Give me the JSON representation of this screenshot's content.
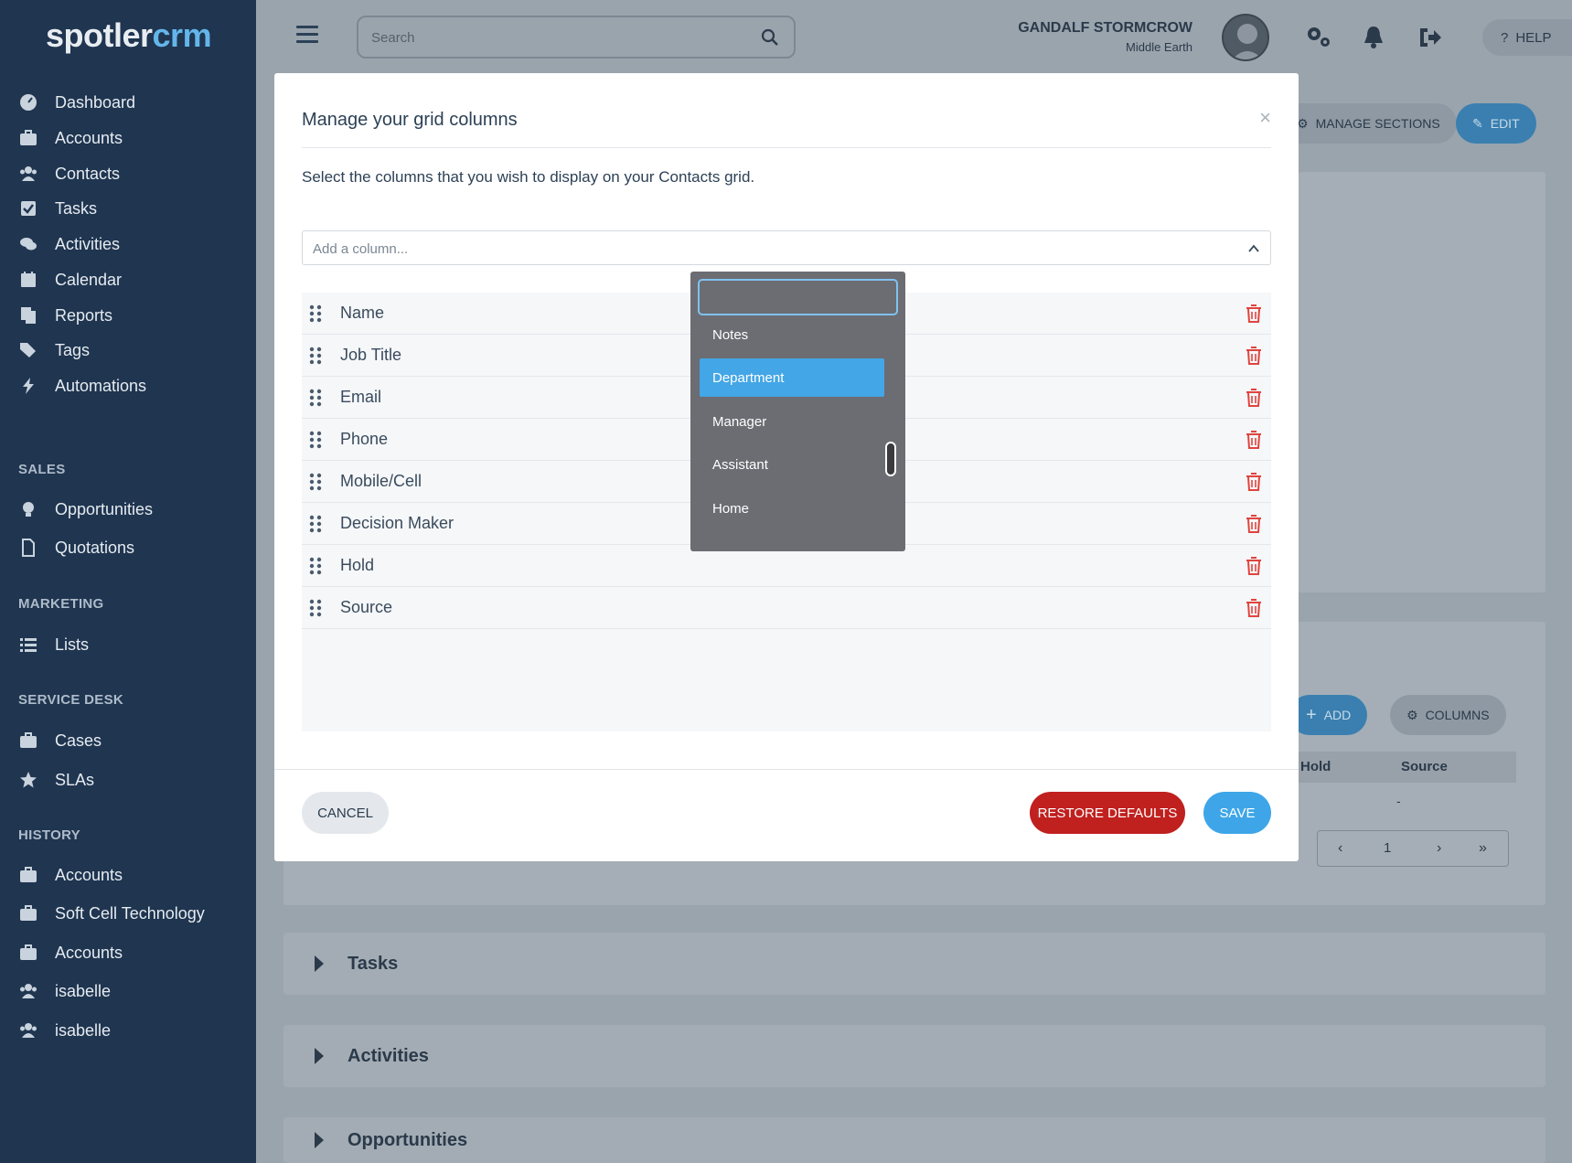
{
  "brand": {
    "part1": "spotler",
    "part2": "crm"
  },
  "sidebar": {
    "main_items": [
      {
        "label": "Dashboard",
        "icon": "dashboard-icon"
      },
      {
        "label": "Accounts",
        "icon": "briefcase-icon"
      },
      {
        "label": "Contacts",
        "icon": "users-icon"
      },
      {
        "label": "Tasks",
        "icon": "checkbox-icon"
      },
      {
        "label": "Activities",
        "icon": "comments-icon"
      },
      {
        "label": "Calendar",
        "icon": "calendar-icon"
      },
      {
        "label": "Reports",
        "icon": "files-icon"
      },
      {
        "label": "Tags",
        "icon": "tags-icon"
      },
      {
        "label": "Automations",
        "icon": "bolt-icon"
      }
    ],
    "sales_title": "SALES",
    "sales_items": [
      {
        "label": "Opportunities",
        "icon": "lightbulb-icon"
      },
      {
        "label": "Quotations",
        "icon": "file-icon"
      }
    ],
    "marketing_title": "MARKETING",
    "marketing_items": [
      {
        "label": "Lists",
        "icon": "list-icon"
      }
    ],
    "service_title": "SERVICE DESK",
    "service_items": [
      {
        "label": "Cases",
        "icon": "case-icon"
      },
      {
        "label": "SLAs",
        "icon": "star-icon"
      }
    ],
    "history_title": "HISTORY",
    "history_items": [
      {
        "label": "Accounts",
        "icon": "briefcase-icon"
      },
      {
        "label": "Soft Cell Technology",
        "icon": "briefcase-icon"
      },
      {
        "label": "Accounts",
        "icon": "briefcase-icon"
      },
      {
        "label": "isabelle",
        "icon": "users-icon"
      },
      {
        "label": "isabelle",
        "icon": "users-icon"
      }
    ]
  },
  "topbar": {
    "search_placeholder": "Search",
    "user_name": "GANDALF STORMCROW",
    "user_location": "Middle Earth",
    "help_label": "HELP"
  },
  "background": {
    "manage_sections_label": "MANAGE SECTIONS",
    "edit_label": "EDIT",
    "add_label": "ADD",
    "columns_label": "COLUMNS",
    "grid_headers": [
      "Hold",
      "Source"
    ],
    "grid_cell": "-",
    "page_number": "1",
    "sections": [
      "Tasks",
      "Activities",
      "Opportunities"
    ]
  },
  "modal": {
    "title": "Manage your grid columns",
    "close": "×",
    "description": "Select the columns that you wish to display on your Contacts grid.",
    "add_placeholder": "Add a column...",
    "columns": [
      "Name",
      "Job Title",
      "Email",
      "Phone",
      "Mobile/Cell",
      "Decision Maker",
      "Hold",
      "Source"
    ],
    "cancel_label": "CANCEL",
    "restore_label": "RESTORE DEFAULTS",
    "save_label": "SAVE"
  },
  "dropdown": {
    "search_value": "",
    "options": [
      "Notes",
      "Department",
      "Manager",
      "Assistant",
      "Home"
    ],
    "selected": "Department"
  },
  "colors": {
    "sidebar_bg": "#1f3550",
    "accent_blue": "#3ea6e8",
    "danger_red": "#c0201e",
    "trash_red": "#e0443f",
    "dropdown_bg": "#6c6c73"
  }
}
